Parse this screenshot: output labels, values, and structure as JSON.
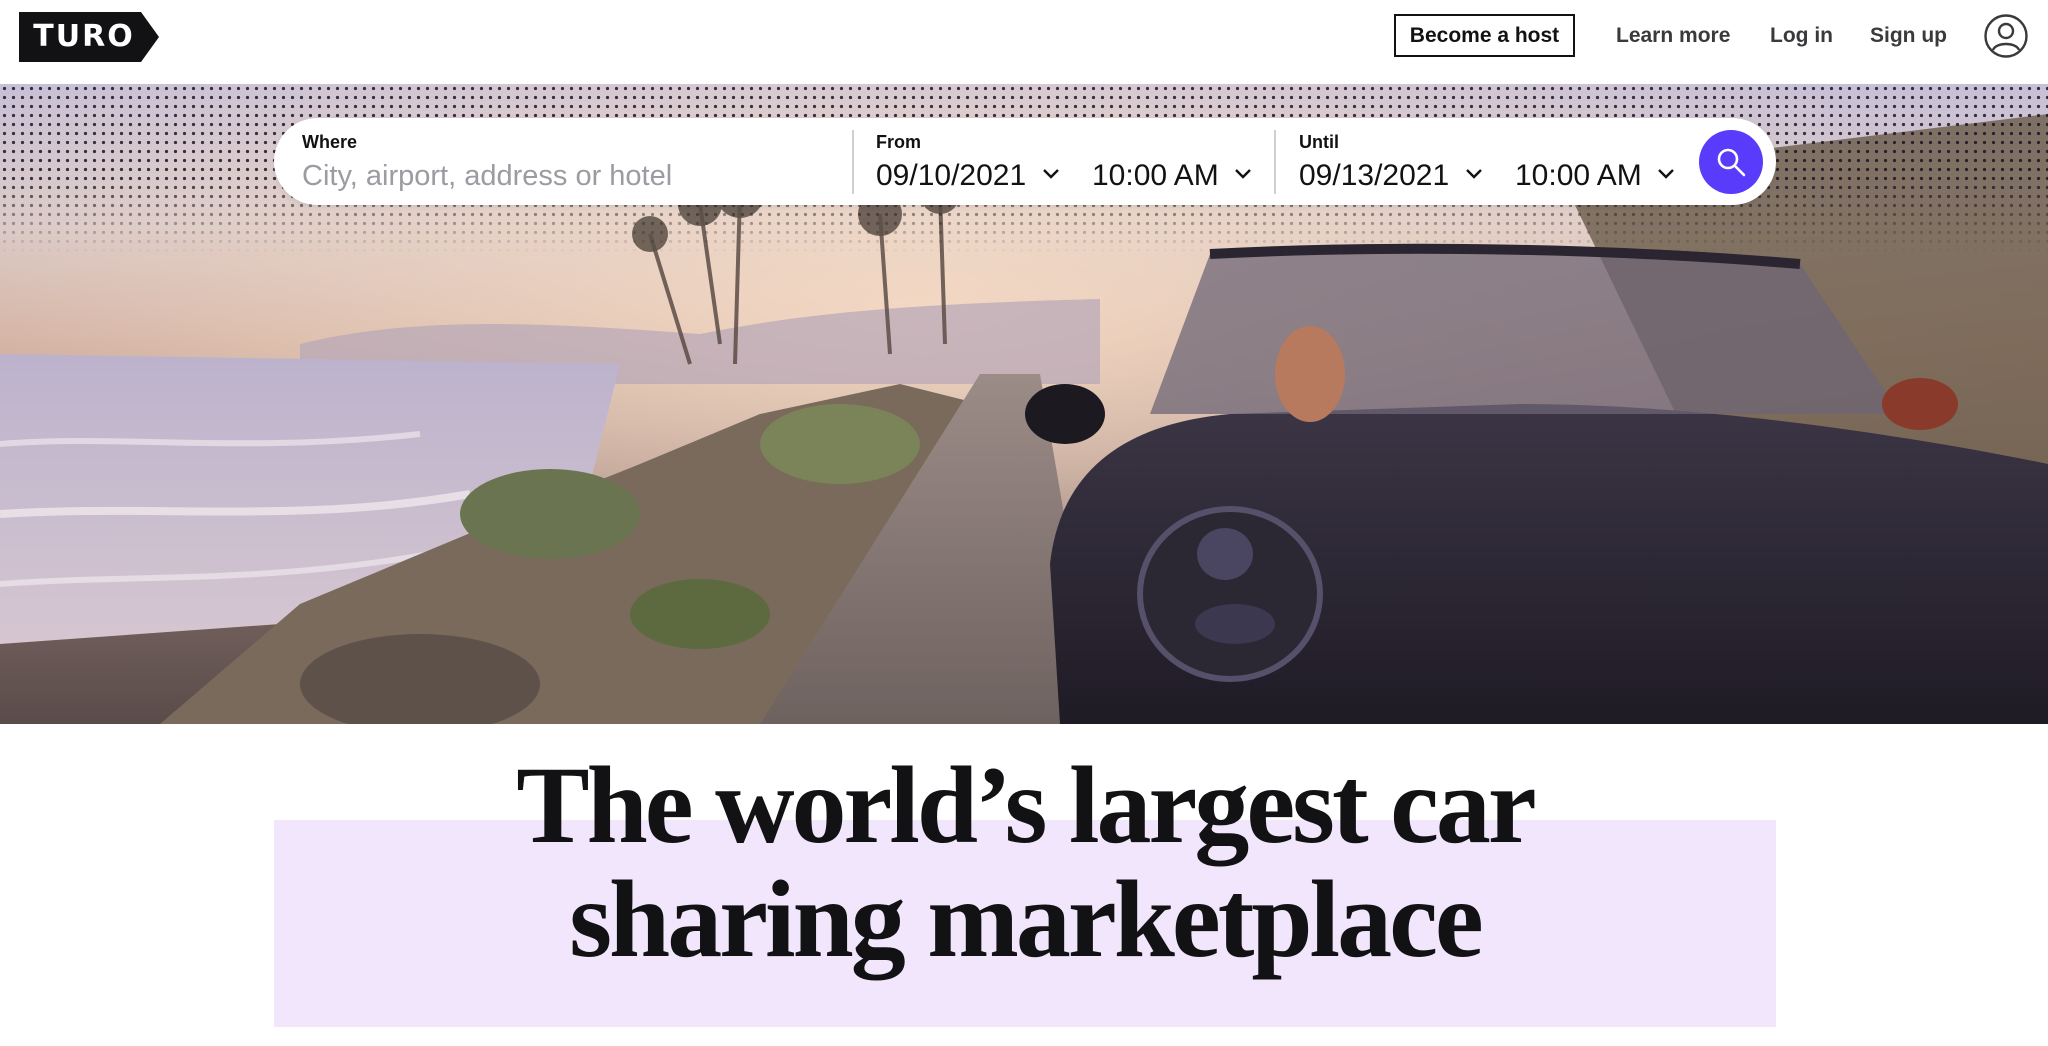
{
  "header": {
    "logo": "TURO",
    "nav": {
      "become_host": "Become a host",
      "learn_more": "Learn more",
      "log_in": "Log in",
      "sign_up": "Sign up"
    }
  },
  "search": {
    "where_label": "Where",
    "where_placeholder": "City, airport, address or hotel",
    "from_label": "From",
    "from_date": "09/10/2021",
    "from_time": "10:00 AM",
    "until_label": "Until",
    "until_date": "09/13/2021",
    "until_time": "10:00 AM"
  },
  "hero": {
    "headline_line1": "The world’s largest car",
    "headline_line2": "sharing marketplace"
  },
  "colors": {
    "brand": "#593cfb",
    "highlight": "#f1e6fb",
    "text": "#121214"
  },
  "icons": [
    "turo-logo",
    "user-icon",
    "chevron-down-icon",
    "search-icon"
  ]
}
